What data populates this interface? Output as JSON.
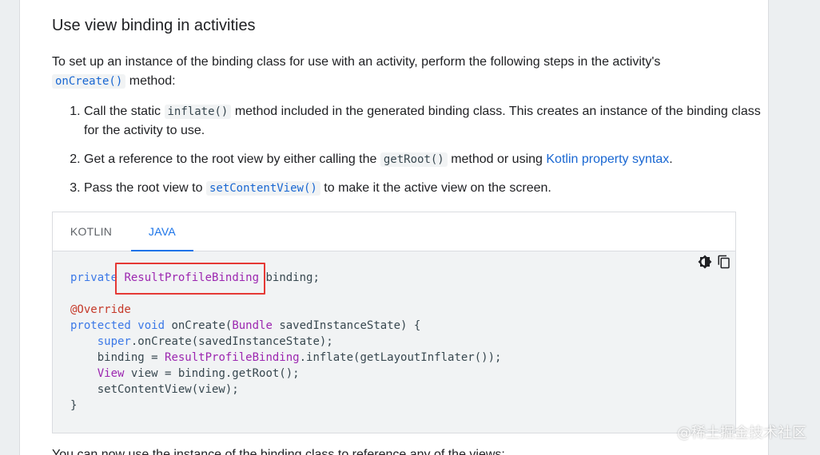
{
  "section": {
    "title": "Use view binding in activities",
    "intro_text": "To set up an instance of the binding class for use with an activity, perform the following steps in the activity's",
    "intro_code": "onCreate()",
    "intro_tail": "method:",
    "steps": [
      {
        "pre": "Call the static",
        "code": "inflate()",
        "post": "method included in the generated binding class. This creates an instance of the binding class for the activity to use."
      },
      {
        "pre": "Get a reference to the root view by either calling the",
        "code": "getRoot()",
        "mid": "method or using",
        "link": "Kotlin property syntax",
        "post": "."
      },
      {
        "pre": "Pass the root view to",
        "code": "setContentView()",
        "post": "to make it the active view on the screen."
      }
    ]
  },
  "code_block": {
    "tabs": [
      "KOTLIN",
      "JAVA"
    ],
    "active_tab": "JAVA",
    "lines": {
      "l1_kw": "private",
      "l1_type": "ResultProfileBinding",
      "l1_rest": "binding;",
      "l3_annot": "@Override",
      "l4_kw1": "protected",
      "l4_kw2": "void",
      "l4_mid": "onCreate(",
      "l4_type": "Bundle",
      "l4_rest": "savedInstanceState) {",
      "l5_kw": "super",
      "l5_rest": ".onCreate(savedInstanceState);",
      "l6_pre": "binding = ",
      "l6_type": "ResultProfileBinding",
      "l6_rest": ".inflate(getLayoutInflater());",
      "l7_type": "View",
      "l7_rest": "view = binding.getRoot();",
      "l8": "setContentView(view);",
      "l9": "}"
    },
    "tools": [
      "theme-toggle-icon",
      "copy-icon"
    ]
  },
  "after_text": "You can now use the instance of the binding class to reference any of the views:",
  "watermark": "@稀土掘金技术社区",
  "colors": {
    "accent": "#1a73e8",
    "highlight_box": "#e53935"
  }
}
